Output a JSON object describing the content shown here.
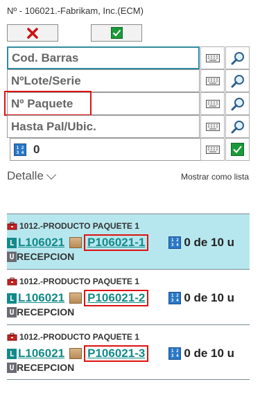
{
  "window": {
    "title": "Nº - 106021.-Fabrikam, Inc.(ECM)"
  },
  "buttons": {
    "cancel": "cancel-x-icon",
    "ok": "confirm-check-icon"
  },
  "fields": [
    {
      "label": "Cod. Barras"
    },
    {
      "label": "NºLote/Serie"
    },
    {
      "label": "Nº Paquete"
    },
    {
      "label": "Hasta Pal/Ubic."
    },
    {
      "label": "0"
    }
  ],
  "detail": {
    "label": "Detalle",
    "list_link": "Mostrar como lista"
  },
  "items": [
    {
      "product": "1012.-PRODUCTO PAQUETE 1",
      "lot_badge": "L",
      "lot": "L106021",
      "package": "P106021-1",
      "qty": "0 de 10 u",
      "loc_badge": "U",
      "location": "RECEPCION"
    },
    {
      "product": "1012.-PRODUCTO PAQUETE 1",
      "lot_badge": "L",
      "lot": "L106021",
      "package": "P106021-2",
      "qty": "0 de 10 u",
      "loc_badge": "U",
      "location": "RECEPCION"
    },
    {
      "product": "1012.-PRODUCTO PAQUETE 1",
      "lot_badge": "L",
      "lot": "L106021",
      "package": "P106021-3",
      "qty": "0 de 10 u",
      "loc_badge": "U",
      "location": "RECEPCION"
    }
  ],
  "colors": {
    "accent": "#138a8a",
    "highlight": "#d11111",
    "selected_bg": "#b7e7ee"
  }
}
